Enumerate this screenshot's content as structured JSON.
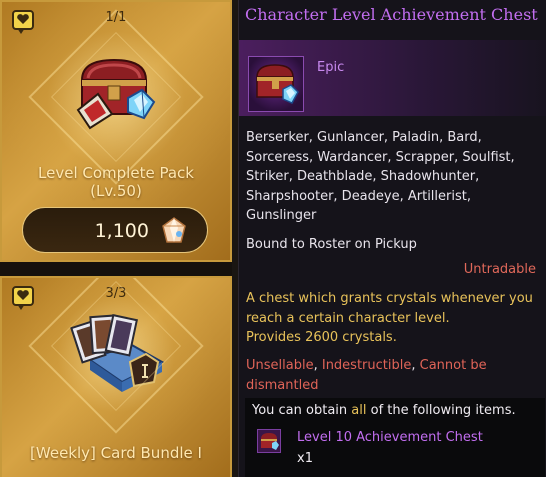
{
  "cards": [
    {
      "stock": "1/1",
      "name_line1": "Level Complete Pack",
      "name_line2": "(Lv.50)",
      "price": "1,100",
      "badge_icon": "chat-heart-icon",
      "item_icon": "chest-icon",
      "currency_icon": "crystal-icon"
    },
    {
      "stock": "3/3",
      "name": "[Weekly] Card Bundle I",
      "badge_icon": "chat-heart-icon",
      "item_icon": "card-bundle-icon"
    }
  ],
  "tooltip": {
    "title": "Character Level Achievement Chest",
    "grade": "Epic",
    "classes": "Berserker, Gunlancer, Paladin, Bard,\nSorceress, Wardancer, Scrapper, Soulfist,\nStriker, Deathblade, Shadowhunter,\nSharpshooter, Deadeye, Artillerist,\nGunslinger",
    "bound": "Bound to Roster on Pickup",
    "untradable": "Untradable",
    "description": "A chest which grants crystals whenever you\nreach a certain character level.\nProvides 2600 crystals.",
    "flags": [
      "Unsellable",
      "Indestructible",
      "Cannot be dismantled"
    ],
    "flag_separator": ",",
    "obtain_prefix": "You can obtain ",
    "obtain_highlight": "all",
    "obtain_suffix": " of the following items.",
    "reward_name": "Level 10 Achievement Chest",
    "reward_qty": "x1"
  },
  "colors": {
    "epic": "#c26ef0",
    "untradable": "#e0685a",
    "description": "#e8c25a",
    "card_gold": "#d6a344"
  }
}
